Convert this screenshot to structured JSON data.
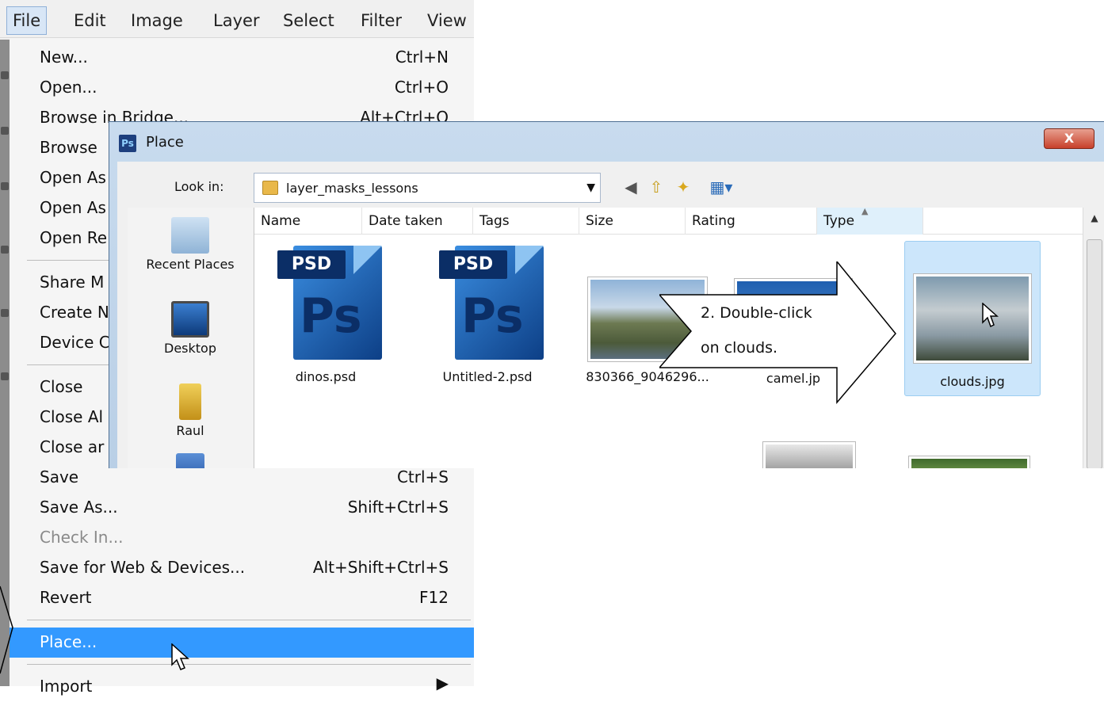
{
  "menubar": {
    "items": [
      "File",
      "Edit",
      "Image",
      "Layer",
      "Select",
      "Filter",
      "View"
    ]
  },
  "file_menu": {
    "items": [
      {
        "label": "New...",
        "shortcut": "Ctrl+N"
      },
      {
        "label": "Open...",
        "shortcut": "Ctrl+O"
      },
      {
        "label": "Browse in Bridge...",
        "shortcut": "Alt+Ctrl+O"
      },
      {
        "label": "Browse",
        "shortcut": ""
      },
      {
        "label": "Open As",
        "shortcut": ""
      },
      {
        "label": "Open As",
        "shortcut": ""
      },
      {
        "label": "Open Re",
        "shortcut": ""
      },
      {
        "label": "Share M",
        "shortcut": ""
      },
      {
        "label": "Create N",
        "shortcut": ""
      },
      {
        "label": "Device C",
        "shortcut": ""
      },
      {
        "label": "Close",
        "shortcut": ""
      },
      {
        "label": "Close Al",
        "shortcut": ""
      },
      {
        "label": "Close ar",
        "shortcut": ""
      },
      {
        "label": "Save",
        "shortcut": "Ctrl+S"
      },
      {
        "label": "Save As...",
        "shortcut": "Shift+Ctrl+S"
      },
      {
        "label": "Check In...",
        "shortcut": ""
      },
      {
        "label": "Save for Web & Devices...",
        "shortcut": "Alt+Shift+Ctrl+S"
      },
      {
        "label": "Revert",
        "shortcut": "F12"
      },
      {
        "label": "Place...",
        "shortcut": ""
      },
      {
        "label": "Import",
        "shortcut": ""
      }
    ]
  },
  "dialog": {
    "title": "Place",
    "logo_text": "Ps",
    "close_label": "X",
    "look_in_label": "Look in:",
    "look_in_value": "layer_masks_lessons",
    "places": [
      "Recent Places",
      "Desktop",
      "Raul"
    ],
    "columns": [
      "Name",
      "Date taken",
      "Tags",
      "Size",
      "Rating",
      "Type"
    ],
    "files": [
      {
        "name": "dinos.psd"
      },
      {
        "name": "Untitled-2.psd"
      },
      {
        "name": "830366_9046296..."
      },
      {
        "name": "camel.jp"
      },
      {
        "name": "clouds.jpg"
      }
    ],
    "psd_badge": "PSD",
    "ps_glyph": "Ps"
  },
  "callout": {
    "line1": "2. Double-click",
    "line2": "on clouds."
  },
  "colors": {
    "menu_highlight": "#3399ff",
    "selected_tile": "#cce6fb",
    "close_button": "#c7402b"
  }
}
